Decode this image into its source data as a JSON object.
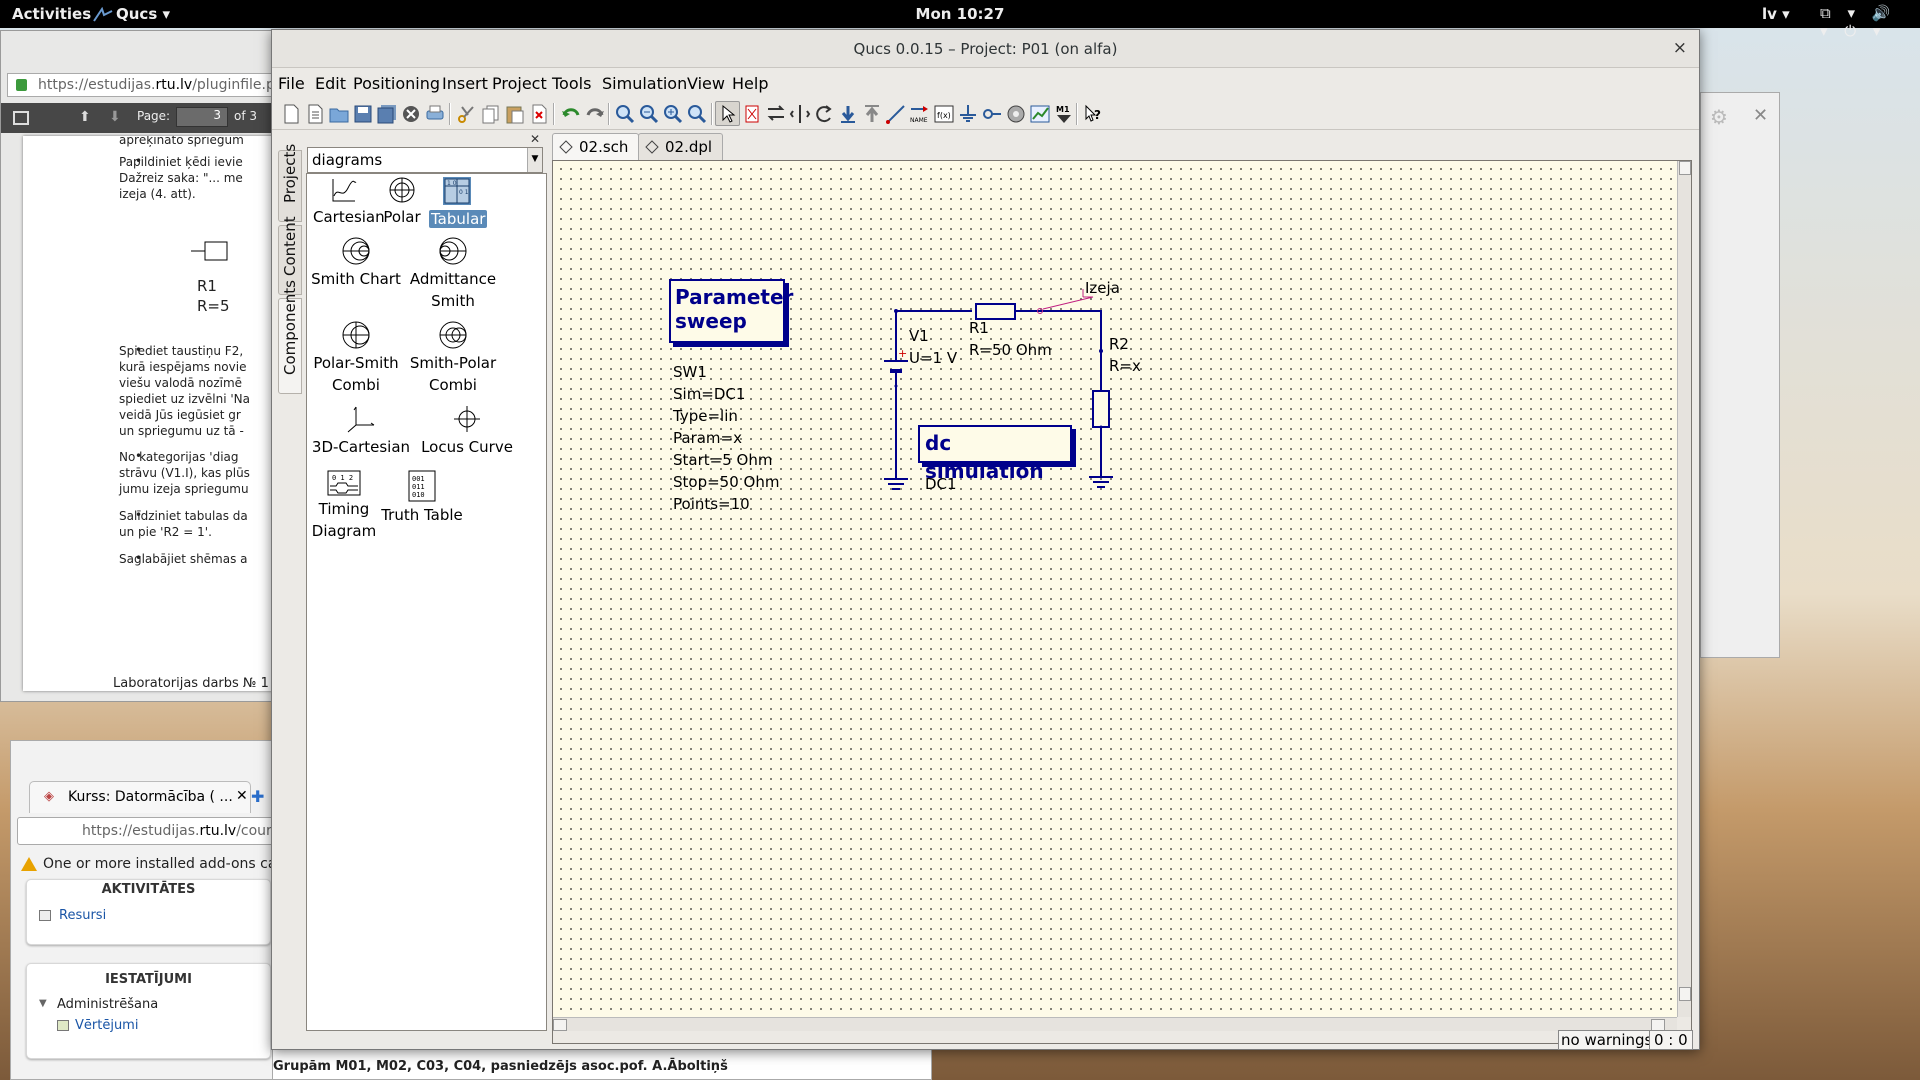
{
  "topbar": {
    "activities": "Activities",
    "app_menu": "Qucs ▾",
    "clock": "Mon 10:27",
    "lang": "lv ▾",
    "tray": "⧉ ▾ 🔊 ▾ ⏻ ▾"
  },
  "pdf": {
    "url_prefix": "https://estudijas.",
    "url_domain": "rtu.lv",
    "url_suffix": "/pluginfile.php",
    "page_label": "Page:",
    "page_value": "3",
    "page_of": "of 3",
    "lines": [
      "aprēķināto spriegum",
      "Papildiniet ķēdi ievie",
      "Dažreiz saka: \"... me",
      "izeja (4. att).",
      "R1",
      "R=5",
      "Spiediet taustiņu F2,",
      "kurā iespējams novie",
      "viešu valodā nozīmē",
      "spiediet uz izvēlni 'Na",
      "veidā Jūs iegūsiet gr",
      "un spriegumu uz tā -",
      "No kategorijas 'diag",
      "strāvu (V1.I), kas plūs",
      "jumu izeja spriegumu",
      "Salīdziniet tabulas da",
      "un pie 'R2 = 1'.",
      "Saglabājiet shēmas a"
    ],
    "footer": "Laboratorijas darbs № 1"
  },
  "firefox": {
    "tab_title": "Kurss: Datormācība ( ...",
    "url_prefix": "https://estudijas.",
    "url_domain": "rtu.lv",
    "url_suffix": "/course",
    "warning": "One or more installed add-ons cann",
    "block1_title": "AKTIVITĀTES",
    "block1_item": "Resursi",
    "block2_title": "IESTATĪJUMI",
    "block2_sub": "Administrēšana",
    "block2_item": "Vērtējumi"
  },
  "docstrip": {
    "text": "Grupām M01, M02, C03, C04, pasniedzējs asoc.pof. A.Āboltiņš"
  },
  "window": {
    "title": "Qucs 0.0.15 – Project: P01 (on alfa)",
    "close": "×"
  },
  "menu": [
    "File",
    "Edit",
    "Positioning",
    "Insert",
    "Project",
    "Tools",
    "Simulation",
    "View",
    "Help"
  ],
  "toolbar_icons": [
    "new-icon",
    "new-text-icon",
    "open-icon",
    "save-icon",
    "save-all-icon",
    "close-document-icon",
    "print-icon",
    "cut-icon",
    "copy-icon",
    "paste-icon",
    "delete-icon",
    "undo-icon",
    "redo-icon",
    "zoom-fit-icon",
    "zoom-all-icon",
    "zoom-in-icon",
    "zoom-out-icon",
    "select-icon",
    "deactivate-icon",
    "mirror-x-icon",
    "mirror-y-icon",
    "rotate-icon",
    "go-into-subcircuit-icon",
    "go-up-icon",
    "wire-icon",
    "wire-label-icon",
    "equation-icon",
    "ground-icon",
    "port-icon",
    "simulate-icon",
    "view-data-icon",
    "marker-icon",
    "whats-this-icon"
  ],
  "dock": {
    "tabs": [
      "Projects",
      "Content",
      "Components"
    ],
    "combo_value": "diagrams",
    "components": [
      {
        "label": "Cartesian",
        "icon": "cartesian-diagram-icon"
      },
      {
        "label": "Polar",
        "icon": "polar-diagram-icon"
      },
      {
        "label": "Tabular",
        "icon": "tabular-diagram-icon",
        "selected": true
      },
      {
        "label": "Smith Chart",
        "icon": "smith-chart-icon"
      },
      {
        "label": "Admittance Smith",
        "icon": "admittance-smith-icon"
      },
      {
        "label": "Polar-Smith Combi",
        "icon": "polar-smith-combi-icon"
      },
      {
        "label": "Smith-Polar Combi",
        "icon": "smith-polar-combi-icon"
      },
      {
        "label": "3D-Cartesian",
        "icon": "3d-cartesian-icon"
      },
      {
        "label": "Locus Curve",
        "icon": "locus-curve-icon"
      },
      {
        "label": "Timing Diagram",
        "icon": "timing-diagram-icon"
      },
      {
        "label": "Truth Table",
        "icon": "truth-table-icon"
      }
    ]
  },
  "doc_tabs": [
    {
      "label": "02.sch",
      "active": true
    },
    {
      "label": "02.dpl",
      "active": false
    }
  ],
  "schematic": {
    "sweep_box": {
      "title_line1": "Parameter",
      "title_line2": "sweep"
    },
    "sweep_props": [
      "SW1",
      "Sim=DC1",
      "Type=lin",
      "Param=x",
      "Start=5 Ohm",
      "Stop=50 Ohm",
      "Points=10"
    ],
    "dc_box": {
      "title": "dc simulation"
    },
    "dc_name": "DC1",
    "v1_name": "V1",
    "v1_value": "U=1 V",
    "r1_name": "R1",
    "r1_value": "R=50 Ohm",
    "r2_name": "R2",
    "r2_value": "R=x",
    "label_izeja": "Izeja",
    "wire_color": "#00008b",
    "label_color": "#c02080"
  },
  "status": {
    "warnings": "no warnings",
    "position": "0 : 0"
  }
}
